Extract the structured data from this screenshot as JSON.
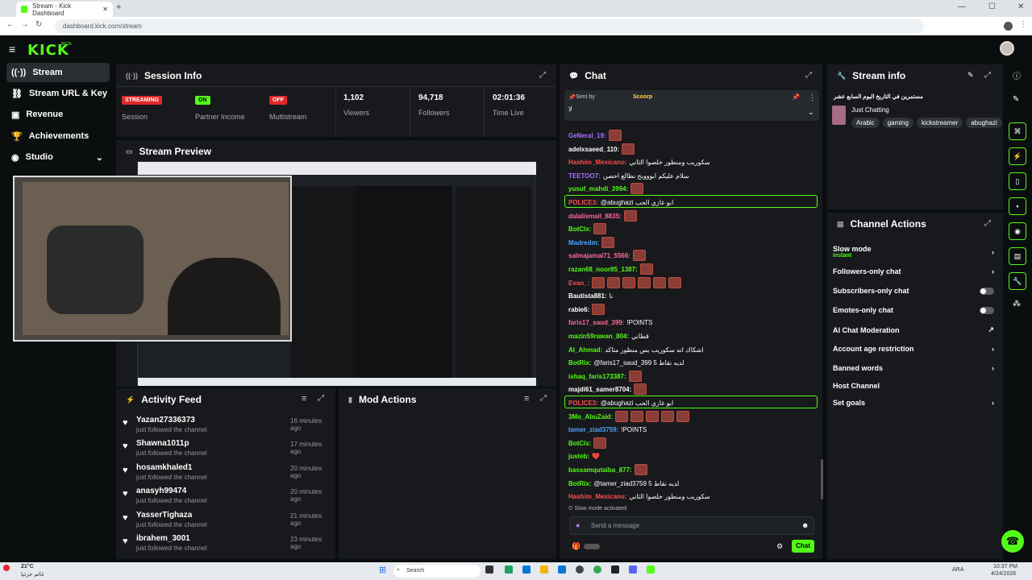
{
  "browser": {
    "tab_title": "Stream - Kick Dashboard",
    "url": "dashboard.kick.com/stream"
  },
  "brand": {
    "logo": "KICK",
    "beta": "BETA",
    "accent": "#53fc18"
  },
  "sidebar": {
    "items": [
      {
        "label": "Stream",
        "icon": "stream-icon"
      },
      {
        "label": "Stream URL & Key",
        "icon": "link-icon"
      },
      {
        "label": "Revenue",
        "icon": "revenue-icon"
      },
      {
        "label": "Achievements",
        "icon": "trophy-icon"
      },
      {
        "label": "Studio",
        "icon": "studio-icon"
      }
    ]
  },
  "session": {
    "title": "Session Info",
    "cells": [
      {
        "badge": "STREAMING",
        "label": "Session"
      },
      {
        "badge": "ON",
        "label": "Partner Income"
      },
      {
        "badge": "OFF",
        "label": "Multistream"
      },
      {
        "value": "1,102",
        "label": "Viewers"
      },
      {
        "value": "94,718",
        "label": "Followers"
      },
      {
        "value": "02:01:36",
        "label": "Time Live"
      }
    ]
  },
  "preview": {
    "title": "Stream Preview"
  },
  "activity": {
    "title": "Activity Feed",
    "items": [
      {
        "name": "Yazan27336373",
        "sub": "just followed the channel",
        "time": "16 minutes ago"
      },
      {
        "name": "Shawna1011p",
        "sub": "just followed the channel",
        "time": "17 minutes ago"
      },
      {
        "name": "hosamkhaled1",
        "sub": "just followed the channel",
        "time": "20 minutes ago"
      },
      {
        "name": "anasyh99474",
        "sub": "just followed the channel",
        "time": "20 minutes ago"
      },
      {
        "name": "YasserTighaza",
        "sub": "just followed the channel",
        "time": "21 minutes ago"
      },
      {
        "name": "ibrahem_3001",
        "sub": "just followed the channel",
        "time": "23 minutes ago"
      }
    ]
  },
  "mod": {
    "title": "Mod Actions"
  },
  "chat": {
    "title": "Chat",
    "pinned_by": "Sent by",
    "pinned_user": "Scoorp",
    "pinned_text": "لا",
    "slow_mode": "Slow mode activated",
    "placeholder": "Send a message",
    "send": "Chat",
    "messages": [
      {
        "user": "GeNeral_19:",
        "text": "",
        "color": "#a970ff",
        "emotes": 1
      },
      {
        "user": "adelxsaeed_110:",
        "text": "",
        "color": "#ffffff",
        "emotes": 1
      },
      {
        "user": "Hashim_Mexicano:",
        "text": "سكوريب ومنطور خلصوا الثاني",
        "color": "#ff4d4d",
        "emotes": 0
      },
      {
        "user": "TEETOO7:",
        "text": "سلام عليكم ابوووبح نطالع احصن",
        "color": "#a970ff",
        "emotes": 0
      },
      {
        "user": "yusuf_mahdi_3994:",
        "text": "",
        "color": "#53fc18",
        "emotes": 1
      },
      {
        "user": "POLICE3:",
        "text": "@abughazi ابو غازي الحب",
        "color": "#ff4d4d",
        "emotes": 0,
        "hl": true
      },
      {
        "user": "dalalismail_8835:",
        "text": "",
        "color": "#ff6b9a",
        "emotes": 1
      },
      {
        "user": "BotClx:",
        "text": "",
        "color": "#53fc18",
        "emotes": 1
      },
      {
        "user": "Madredm:",
        "text": "",
        "color": "#4da3ff",
        "emotes": 1
      },
      {
        "user": "salmajamal71_5566:",
        "text": "",
        "color": "#ff6b9a",
        "emotes": 1
      },
      {
        "user": "razan68_noor85_1387:",
        "text": "",
        "color": "#53fc18",
        "emotes": 1
      },
      {
        "user": "Evan_:",
        "text": "",
        "color": "#ff4d4d",
        "emotes": 6
      },
      {
        "user": "Bautista881:",
        "text": "نا",
        "color": "#ffffff",
        "emotes": 0
      },
      {
        "user": "rabie6:",
        "text": "",
        "color": "#ffffff",
        "emotes": 1
      },
      {
        "user": "faris17_saud_399:",
        "text": "!POINTS",
        "color": "#ff6b9a",
        "emotes": 0
      },
      {
        "user": "mazin59rawan_804:",
        "text": "قطاني",
        "color": "#53fc18",
        "emotes": 0
      },
      {
        "user": "Al_Ahmad:",
        "text": "اشكاك انه سكوريب بس منظور متاكد",
        "color": "#53fc18",
        "emotes": 0
      },
      {
        "user": "BotRix:",
        "text": "@faris17_saud_399 لديه نقاط 5",
        "color": "#53fc18",
        "emotes": 0
      },
      {
        "user": "ishaq_faris173387:",
        "text": "",
        "color": "#53fc18",
        "emotes": 1
      },
      {
        "user": "majdi61_samer8704:",
        "text": "",
        "color": "#ffffff",
        "emotes": 1
      },
      {
        "user": "POLICE3:",
        "text": "@abughazi ابو غازي الحب",
        "color": "#ff4d4d",
        "emotes": 0,
        "hl": true
      },
      {
        "user": "3Mo_AbuZaid:",
        "text": "",
        "color": "#53fc18",
        "emotes": 5
      },
      {
        "user": "tamer_ziad3759:",
        "text": "!POINTS",
        "color": "#4da3ff",
        "emotes": 0
      },
      {
        "user": "BotClx:",
        "text": "",
        "color": "#53fc18",
        "emotes": 1
      },
      {
        "user": "justeb:",
        "text": "❤️",
        "color": "#53fc18",
        "emotes": 0
      },
      {
        "user": "bassamqutaiba_877:",
        "text": "",
        "color": "#53fc18",
        "emotes": 1
      },
      {
        "user": "BotRix:",
        "text": "@tamer_ziad3759 لديه نقاط 5",
        "color": "#53fc18",
        "emotes": 0
      },
      {
        "user": "Hashim_Mexicano:",
        "text": "سكوريب ومنطور خلصوا الثاني",
        "color": "#ff4d4d",
        "emotes": 0
      }
    ]
  },
  "streaminfo": {
    "title": "Stream info",
    "stream_title": "مستمرين في التاريخ اليوم السابع عشر",
    "category": "Just Chatting",
    "tags": [
      "Arabic",
      "gaming",
      "kickstreamer",
      "abughazi"
    ]
  },
  "actions": {
    "title": "Channel Actions",
    "rows": [
      {
        "label": "Slow mode",
        "sub": "Instant",
        "ctrl": "chevron"
      },
      {
        "label": "Followers-only chat",
        "ctrl": "chevron"
      },
      {
        "label": "Subscribers-only chat",
        "ctrl": "toggle"
      },
      {
        "label": "Emotes-only chat",
        "ctrl": "toggle"
      },
      {
        "label": "AI Chat Moderation",
        "ctrl": "external"
      },
      {
        "label": "Account age restriction",
        "ctrl": "chevron"
      },
      {
        "label": "Banned words",
        "ctrl": "chevron"
      },
      {
        "label": "Host Channel",
        "ctrl": "none"
      },
      {
        "label": "Set goals",
        "ctrl": "chevron"
      }
    ]
  },
  "taskbar": {
    "weather": "21°C",
    "weather_sub": "غائم جزئيا",
    "search": "Search",
    "lang": "ARA",
    "time": "10:37 PM",
    "date": "4/24/2026"
  }
}
